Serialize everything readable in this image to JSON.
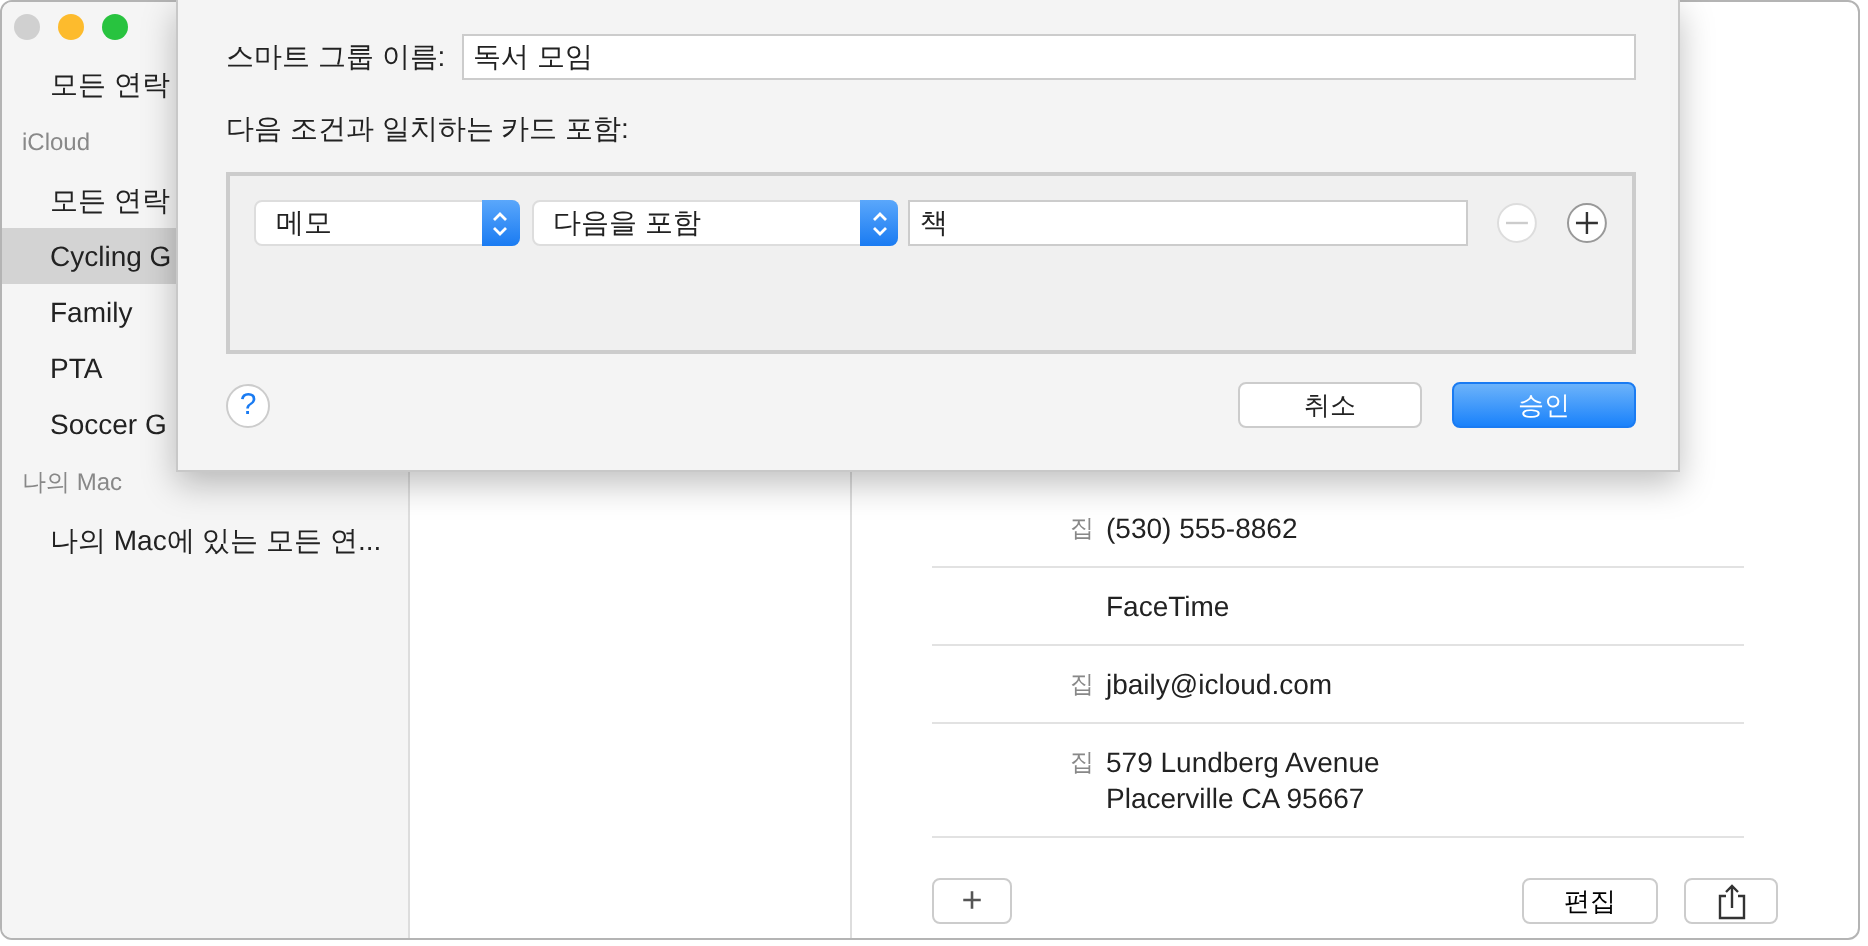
{
  "sidebar": {
    "sections": [
      {
        "items": [
          {
            "label": "모든 연락",
            "selected": false
          }
        ]
      },
      {
        "header": "iCloud",
        "items": [
          {
            "label": "모든 연락",
            "selected": false
          },
          {
            "label": "Cycling G",
            "selected": true
          },
          {
            "label": "Family",
            "selected": false
          },
          {
            "label": "PTA",
            "selected": false
          },
          {
            "label": "Soccer G",
            "selected": false
          }
        ]
      },
      {
        "header": "나의 Mac",
        "items": [
          {
            "label": "나의 Mac에 있는 모든 연...",
            "selected": false
          }
        ]
      }
    ]
  },
  "card": {
    "rows": [
      {
        "label": "집",
        "lines": [
          "(530) 555-8862"
        ]
      },
      {
        "lines": [
          "FaceTime"
        ]
      },
      {
        "label": "집",
        "lines": [
          "jbaily@icloud.com"
        ]
      },
      {
        "label": "집",
        "lines": [
          "579 Lundberg Avenue",
          "Placerville CA 95667"
        ]
      }
    ],
    "add_button": "+",
    "edit_button": "편집"
  },
  "dialog": {
    "name_label": "스마트 그룹 이름:",
    "name_value": "독서 모임",
    "criteria_label": "다음 조건과 일치하는 카드 포함:",
    "conditions": [
      {
        "field": "메모",
        "operator": "다음을 포함",
        "value": "책",
        "can_remove": false
      }
    ],
    "help": "?",
    "cancel": "취소",
    "ok": "승인"
  }
}
